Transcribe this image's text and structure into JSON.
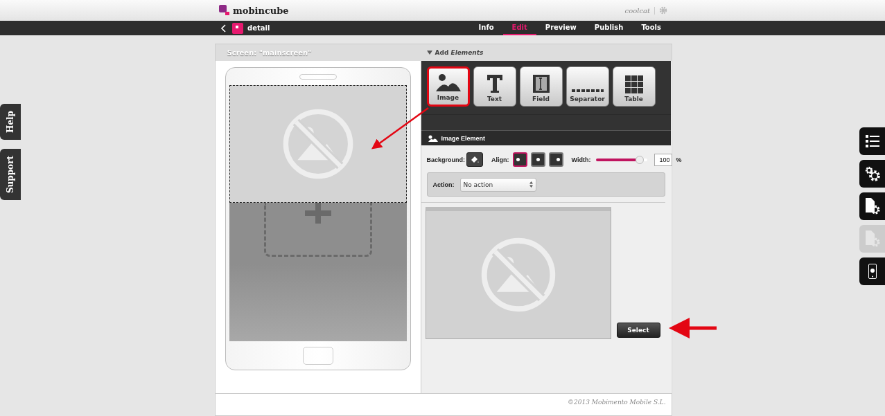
{
  "header": {
    "logo": "mobincube",
    "user": "coolcat"
  },
  "nav": {
    "title": "detail",
    "tabs": [
      {
        "label": "Info",
        "selected": false
      },
      {
        "label": "Edit",
        "selected": true
      },
      {
        "label": "Preview",
        "selected": false
      },
      {
        "label": "Publish",
        "selected": false
      },
      {
        "label": "Tools",
        "selected": false
      }
    ]
  },
  "side_tabs": [
    "Help",
    "Support"
  ],
  "tool_tabs": [
    {
      "kind": "list",
      "disabled": false
    },
    {
      "kind": "gears",
      "disabled": false
    },
    {
      "kind": "page-gear",
      "disabled": false
    },
    {
      "kind": "table-gear",
      "disabled": true
    },
    {
      "kind": "phone",
      "disabled": false
    }
  ],
  "screen_title": "Screen: \"mainscreen\"",
  "add_elements": "Add *Elements*",
  "elements": [
    {
      "kind": "image",
      "label": "Image",
      "selected": true
    },
    {
      "kind": "text",
      "label": "Text",
      "selected": false
    },
    {
      "kind": "field",
      "label": "Field",
      "selected": false
    },
    {
      "kind": "separator",
      "label": "Separator",
      "selected": false
    },
    {
      "kind": "table",
      "label": "Table",
      "selected": false
    }
  ],
  "panel": {
    "title": "Image Element",
    "background_label": "Background:",
    "align_label": "Align:",
    "align": [
      {
        "kind": "left",
        "selected": true
      },
      {
        "kind": "center",
        "selected": false
      },
      {
        "kind": "right",
        "selected": false
      }
    ],
    "width_label": "Width:",
    "width": {
      "level": 0.85,
      "value": "100",
      "unit": "%"
    },
    "action_label": "Action:",
    "action": "No action",
    "select_button": "Select"
  },
  "footer": "©2013 Mobimento Mobile S.L."
}
